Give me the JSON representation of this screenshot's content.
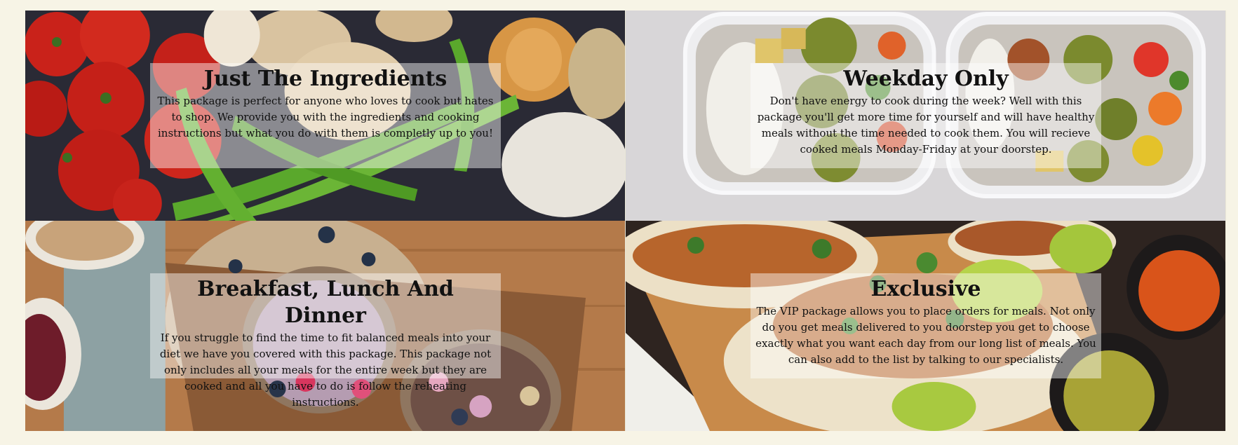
{
  "packages": [
    {
      "title": "Just The Ingredients",
      "description": "This package is perfect for anyone who loves to cook but hates to shop. We provide you with the ingredients and cooking instructions but what you do with them is completly up to you!",
      "image_icon": "vegetables-photo"
    },
    {
      "title": "Weekday Only",
      "description": "Don't have energy to cook during the week? Well with this package you'll get more time for yourself and will have healthy meals without the time needed to cook them. You will recieve cooked meals Monday-Friday at your doorstep.",
      "image_icon": "meal-prep-containers-photo"
    },
    {
      "title": "Breakfast, Lunch And Dinner",
      "description": "If you struggle to find the time to fit balanced meals into your diet we have you covered with this package. This package not only includes all your meals for the entire week but they are cooked and all you have to do is follow the reheating instructions.",
      "image_icon": "smoothie-bowls-photo"
    },
    {
      "title": "Exclusive",
      "description": "The VIP package allows you to place orders for meals. Not only do you get meals delivered to you doorstep you get to choose exactly what you want each day from our long list of meals. You can also add to the list by talking to our specialists.",
      "image_icon": "tacos-photo"
    }
  ],
  "colors": {
    "page_background": "#f7f4e6",
    "panel_overlay": "rgba(255,255,255,0.45)",
    "text": "#111111"
  }
}
